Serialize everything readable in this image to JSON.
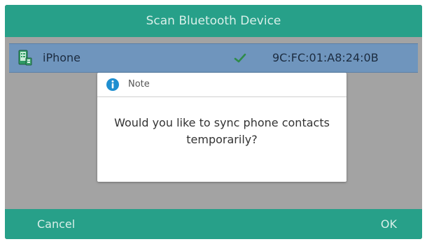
{
  "header": {
    "title": "Scan Bluetooth Device"
  },
  "device": {
    "name": "iPhone",
    "mac": "9C:FC:01:A8:24:0B",
    "icon": "phone-contacts-icon",
    "status_icon": "check-icon"
  },
  "dialog": {
    "icon": "info-icon",
    "title": "Note",
    "message": "Would you like to sync phone contacts temporarily?"
  },
  "softkeys": {
    "cancel_label": "Cancel",
    "ok_label": "OK"
  },
  "colors": {
    "accent": "#27a089",
    "selection": "#6f95bd",
    "info": "#1f8fd0"
  }
}
